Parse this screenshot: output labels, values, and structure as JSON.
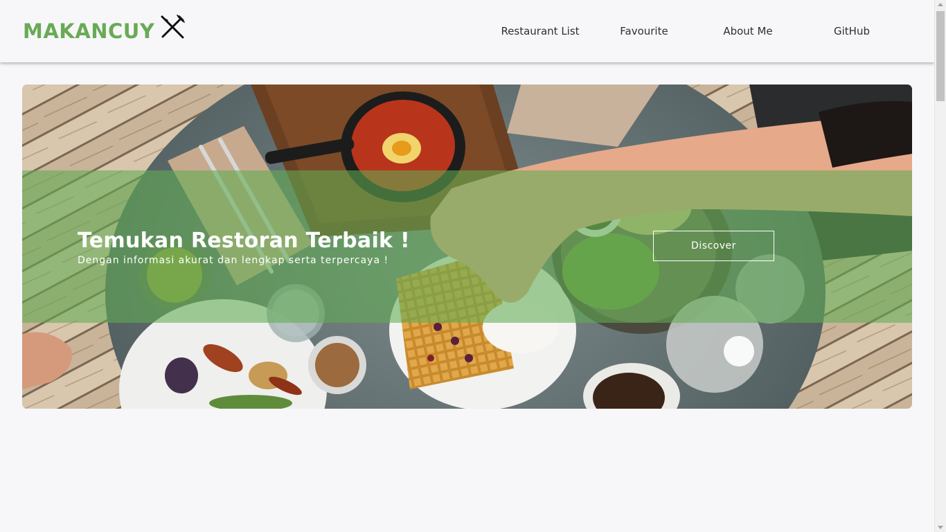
{
  "header": {
    "brand_name": "MAKANCUY",
    "brand_icon": "fork-knife-icon",
    "nav": [
      {
        "label": "Restaurant List"
      },
      {
        "label": "Favourite"
      },
      {
        "label": "About Me"
      },
      {
        "label": "GitHub"
      }
    ]
  },
  "hero": {
    "title": "Temukan Restoran Terbaik !",
    "subtitle": "Dengan informasi akurat dan lengkap serta terpercaya !",
    "button_label": "Discover"
  },
  "colors": {
    "brand": "#6aaa56",
    "page_background": "#f7f7f9",
    "hero_overlay": "#60ac52",
    "nav_text": "#2f2f2f"
  }
}
